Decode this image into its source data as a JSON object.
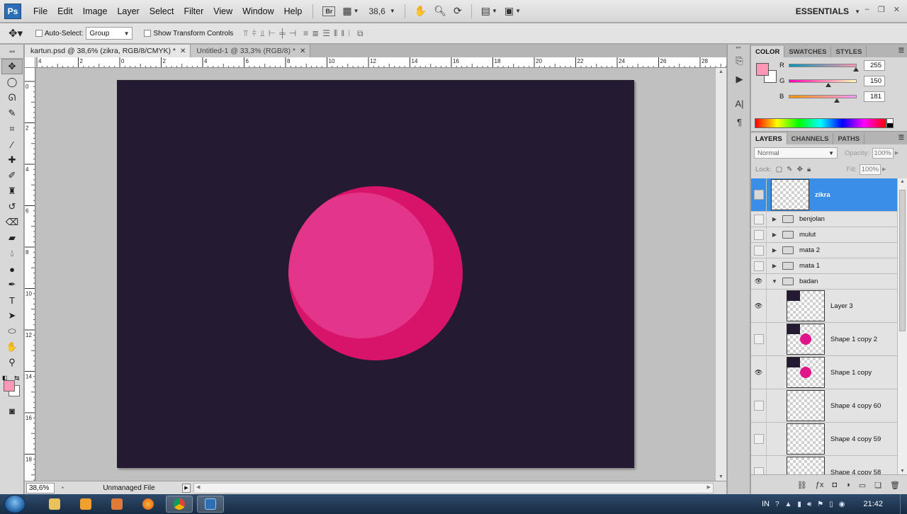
{
  "app": {
    "logo_text": "Ps",
    "menu": [
      "File",
      "Edit",
      "Image",
      "Layer",
      "Select",
      "Filter",
      "View",
      "Window",
      "Help"
    ],
    "bridge_label": "Br",
    "zoom_level": "38,6",
    "workspace": "ESSENTIALS"
  },
  "options_bar": {
    "auto_select_label": "Auto-Select:",
    "auto_select_value": "Group",
    "show_transform_label": "Show Transform Controls"
  },
  "documents": {
    "tabs": [
      {
        "label": "kartun.psd @ 38,6% (zikra, RGB/8/CMYK) *",
        "active": true
      },
      {
        "label": "Untitled-1 @ 33,3% (RGB/8) *",
        "active": false
      }
    ],
    "canvas_color": "#241a32",
    "ball_colors": {
      "main": "#e3358a",
      "shade": "#d7136a"
    }
  },
  "ruler": {
    "top_labels": [
      "4",
      "2",
      "0",
      "2",
      "4",
      "6",
      "8",
      "10",
      "12",
      "14",
      "16",
      "18",
      "20",
      "22",
      "24",
      "26",
      "28"
    ],
    "left_labels": [
      "0",
      "2",
      "4",
      "6",
      "8",
      "10",
      "12",
      "14",
      "16",
      "18"
    ]
  },
  "status": {
    "zoom": "38,6%",
    "file_info": "Unmanaged File"
  },
  "color_panel": {
    "tabs": [
      "COLOR",
      "SWATCHES",
      "STYLES"
    ],
    "foreground": "#ff96b5",
    "background": "#ffffff",
    "channels": [
      {
        "label": "R",
        "value": "255",
        "fraction": 1.0
      },
      {
        "label": "G",
        "value": "150",
        "fraction": 0.588
      },
      {
        "label": "B",
        "value": "181",
        "fraction": 0.71
      }
    ]
  },
  "layers_panel": {
    "tabs": [
      "LAYERS",
      "CHANNELS",
      "PATHS"
    ],
    "blend_mode": "Normal",
    "opacity_label": "Opacity:",
    "opacity": "100%",
    "lock_label": "Lock:",
    "fill_label": "Fill:",
    "fill": "100%",
    "layers": [
      {
        "name": "zikra",
        "kind": "layer",
        "visible": false,
        "selected": true,
        "thumb": "empty"
      },
      {
        "name": "benjolan",
        "kind": "group",
        "visible": false,
        "expanded": false
      },
      {
        "name": "mulut",
        "kind": "group",
        "visible": false,
        "expanded": false
      },
      {
        "name": "mata 2",
        "kind": "group",
        "visible": false,
        "expanded": false
      },
      {
        "name": "mata 1",
        "kind": "group",
        "visible": false,
        "expanded": false
      },
      {
        "name": "badan",
        "kind": "group",
        "visible": true,
        "expanded": true
      },
      {
        "name": "Layer 3",
        "kind": "layer",
        "visible": true,
        "indent": true,
        "thumb": "dark"
      },
      {
        "name": "Shape 1 copy 2",
        "kind": "layer",
        "visible": false,
        "indent": true,
        "thumb": "ball"
      },
      {
        "name": "Shape 1 copy",
        "kind": "layer",
        "visible": true,
        "indent": true,
        "thumb": "ball"
      },
      {
        "name": "Shape 4 copy 60",
        "kind": "layer",
        "visible": false,
        "indent": true,
        "thumb": "empty"
      },
      {
        "name": "Shape 4 copy 59",
        "kind": "layer",
        "visible": false,
        "indent": true,
        "thumb": "empty"
      },
      {
        "name": "Shape 4 copy 58",
        "kind": "layer",
        "visible": false,
        "indent": true,
        "thumb": "empty"
      }
    ]
  },
  "taskbar": {
    "tray_lang": "IN",
    "clock": "21:42"
  }
}
